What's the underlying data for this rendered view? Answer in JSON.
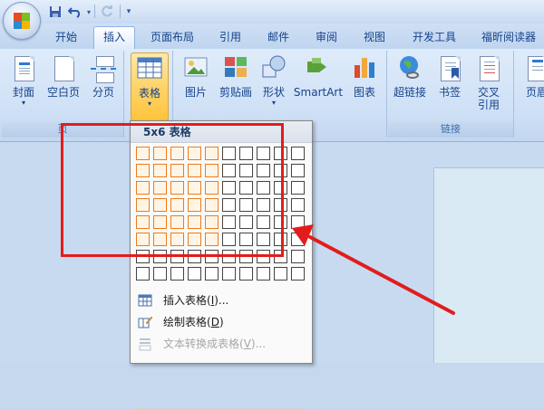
{
  "quick_access": {
    "save_icon": "save-icon",
    "undo_icon": "undo-icon",
    "redo_icon": "redo-icon",
    "customize_icon": "customize-icon"
  },
  "tabs": [
    {
      "label": "开始"
    },
    {
      "label": "插入",
      "active": true
    },
    {
      "label": "页面布局"
    },
    {
      "label": "引用"
    },
    {
      "label": "邮件"
    },
    {
      "label": "审阅"
    },
    {
      "label": "视图"
    },
    {
      "label": "开发工具"
    },
    {
      "label": "福昕阅读器"
    }
  ],
  "ribbon": {
    "pages_group": {
      "label": "页",
      "buttons": [
        {
          "label": "封面",
          "icon": "cover-page-icon",
          "dropdown": true
        },
        {
          "label": "空白页",
          "icon": "blank-page-icon"
        },
        {
          "label": "分页",
          "icon": "page-break-icon"
        }
      ]
    },
    "table_group": {
      "buttons": [
        {
          "label": "表格",
          "icon": "table-icon",
          "dropdown": true
        }
      ]
    },
    "illustrations_group": {
      "buttons": [
        {
          "label": "图片",
          "icon": "picture-icon"
        },
        {
          "label": "剪贴画",
          "icon": "clipart-icon"
        },
        {
          "label": "形状",
          "icon": "shapes-icon",
          "dropdown": true
        },
        {
          "label": "SmartArt",
          "icon": "smartart-icon"
        },
        {
          "label": "图表",
          "icon": "chart-icon"
        }
      ]
    },
    "links_group": {
      "label": "链接",
      "buttons": [
        {
          "label": "超链接",
          "icon": "hyperlink-icon"
        },
        {
          "label": "书签",
          "icon": "bookmark-icon"
        },
        {
          "label": "交叉\n引用",
          "line1": "交叉",
          "line2": "引用",
          "icon": "cross-reference-icon"
        }
      ]
    },
    "header_group": {
      "buttons": [
        {
          "label": "页眉",
          "icon": "header-icon"
        }
      ]
    }
  },
  "table_dropdown": {
    "header": "5x6 表格",
    "grid": {
      "columns": 10,
      "rows": 8,
      "selected_columns": 5,
      "selected_rows": 6
    },
    "menu_items": [
      {
        "label": "插入表格(I)...",
        "text": "插入表格(",
        "key": "I",
        "suffix": ")...",
        "icon": "insert-table-icon",
        "enabled": true
      },
      {
        "label": "绘制表格(D)",
        "text": "绘制表格(",
        "key": "D",
        "suffix": ")",
        "icon": "draw-table-icon",
        "enabled": true
      },
      {
        "label": "文本转换成表格(V)...",
        "text": "文本转换成表格(",
        "key": "V",
        "suffix": ")...",
        "icon": "text-to-table-icon",
        "enabled": false
      }
    ]
  },
  "annotation": {
    "color": "#e21c1c"
  }
}
